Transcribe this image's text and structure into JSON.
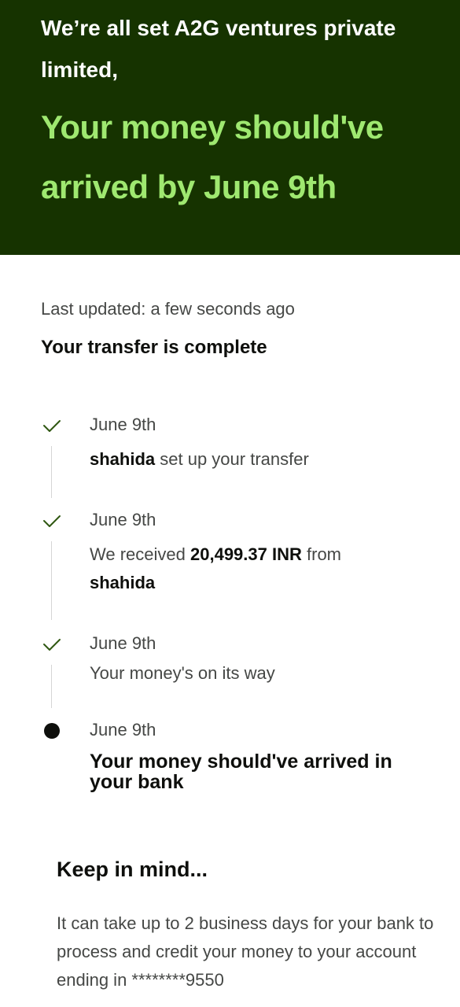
{
  "hero": {
    "greeting": "We’re all set A2G ventures private limited,",
    "headline": "Your money should've arrived by June 9th"
  },
  "status": {
    "last_updated": "Last updated: a few seconds ago",
    "summary": "Your transfer is complete"
  },
  "timeline": [
    {
      "state": "done",
      "date": "June 9th",
      "desc_name": "shahida",
      "desc_text": "set up your transfer"
    },
    {
      "state": "done",
      "date": "June 9th",
      "desc_prefix": "We received",
      "amount": "20,499.37 INR",
      "desc_from": "from",
      "desc_name": "shahida"
    },
    {
      "state": "done",
      "date": "June 9th",
      "desc_text": "Your money's on its way"
    },
    {
      "state": "current",
      "date": "June 9th",
      "desc_text": "Your money should've arrived in your bank"
    }
  ],
  "keep_in_mind": {
    "title": "Keep in mind...",
    "body": "It can take up to 2 business days for your bank to process and credit your money to your account ending in ********9550"
  },
  "colors": {
    "hero_bg": "#163300",
    "hero_accent": "#9fe870",
    "check": "#2f5711"
  },
  "icons": {
    "done": "check-icon",
    "current": "dot-icon"
  }
}
